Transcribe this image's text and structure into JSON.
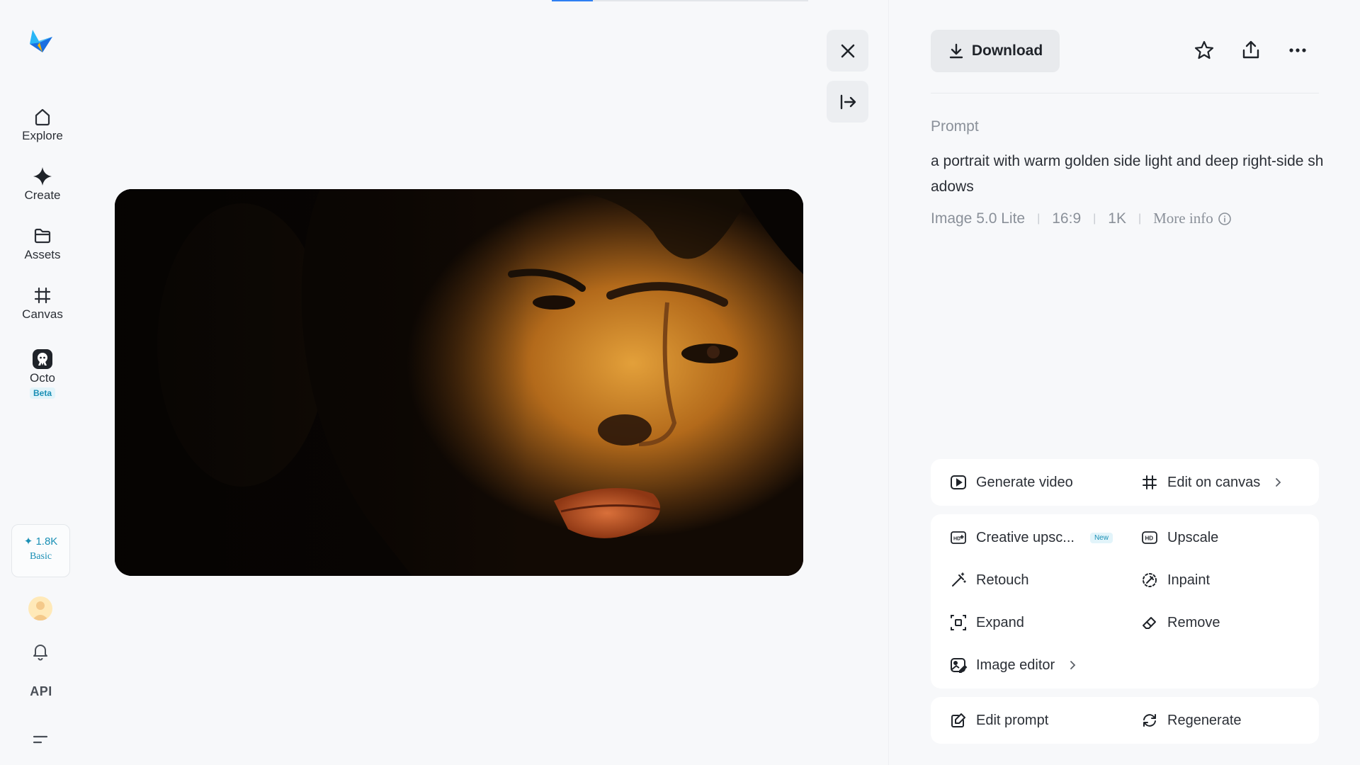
{
  "progress": {
    "fraction": 0.16
  },
  "sidebar": {
    "logo_icon": "paper-plane-logo",
    "items": [
      {
        "label": "Explore",
        "icon": "home-icon"
      },
      {
        "label": "Create",
        "icon": "sparkle-icon"
      },
      {
        "label": "Assets",
        "icon": "folder-icon"
      },
      {
        "label": "Canvas",
        "icon": "frame-icon"
      },
      {
        "label": "Octo",
        "icon": "octo-icon",
        "badge": "Beta"
      }
    ],
    "credits": {
      "amount": "✦ 1.8K",
      "plan": "Basic"
    },
    "api_label": "API"
  },
  "viewer": {
    "image_description_icon": "portrait-image",
    "close_icon": "close-icon",
    "collapse_icon": "collapse-panel-icon"
  },
  "panel": {
    "download_label": "Download",
    "prompt_title": "Prompt",
    "prompt_text": "a portrait with warm golden side light and deep right-side shadows",
    "meta": [
      "Image 5.0 Lite",
      "16:9",
      "1K"
    ],
    "more_info": "More info",
    "actions_primary": [
      {
        "label": "Generate video",
        "icon": "play-square-icon"
      },
      {
        "label": "Edit on canvas",
        "icon": "frame-icon"
      }
    ],
    "actions_tools": [
      {
        "label": "Creative upsc...",
        "icon": "hd-plus-icon",
        "badge": "New"
      },
      {
        "label": "Upscale",
        "icon": "hd-icon"
      },
      {
        "label": "Retouch",
        "icon": "magic-wand-icon"
      },
      {
        "label": "Inpaint",
        "icon": "inpaint-icon"
      },
      {
        "label": "Expand",
        "icon": "expand-icon"
      },
      {
        "label": "Remove",
        "icon": "eraser-icon"
      },
      {
        "label": "Image editor",
        "icon": "image-edit-icon"
      }
    ],
    "actions_bottom": [
      {
        "label": "Edit prompt",
        "icon": "edit-icon"
      },
      {
        "label": "Regenerate",
        "icon": "refresh-icon"
      }
    ]
  },
  "colors": {
    "accent": "#2f7ff2",
    "teal": "#1a8fb5",
    "background": "#f7f8fa"
  }
}
